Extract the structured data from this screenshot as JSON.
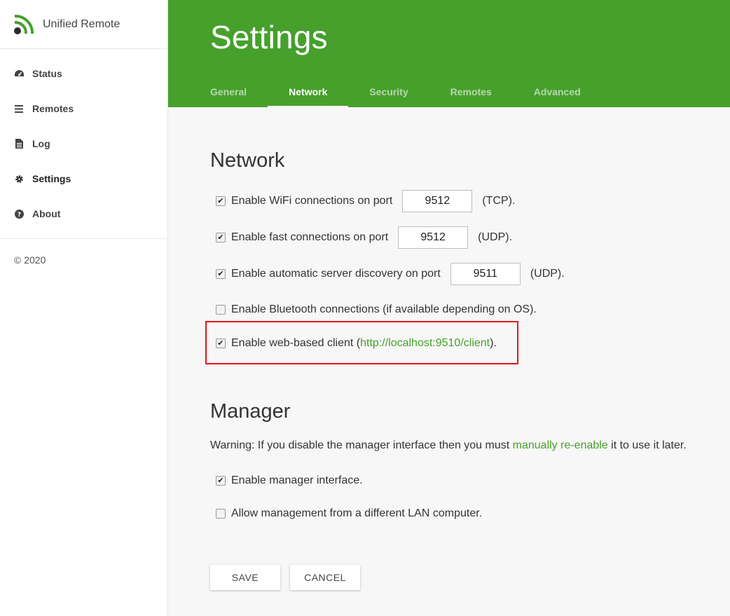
{
  "app": {
    "name": "Unified Remote",
    "copyright": "© 2020"
  },
  "colors": {
    "brand": "#46a02b",
    "highlight": "#e8141b"
  },
  "sidebar": {
    "items": [
      {
        "label": "Status",
        "icon": "dashboard-icon"
      },
      {
        "label": "Remotes",
        "icon": "menu-icon"
      },
      {
        "label": "Log",
        "icon": "document-icon"
      },
      {
        "label": "Settings",
        "icon": "gear-icon",
        "active": true
      },
      {
        "label": "About",
        "icon": "question-icon"
      }
    ]
  },
  "header": {
    "title": "Settings",
    "tabs": [
      {
        "label": "General"
      },
      {
        "label": "Network",
        "active": true
      },
      {
        "label": "Security"
      },
      {
        "label": "Remotes"
      },
      {
        "label": "Advanced"
      }
    ]
  },
  "network": {
    "title": "Network",
    "wifi": {
      "checked": true,
      "label": "Enable WiFi connections on port",
      "port": "9512",
      "suffix": "(TCP)."
    },
    "fast": {
      "checked": true,
      "label": "Enable fast connections on port",
      "port": "9512",
      "suffix": "(UDP)."
    },
    "discovery": {
      "checked": true,
      "label": "Enable automatic server discovery on port",
      "port": "9511",
      "suffix": "(UDP)."
    },
    "bluetooth": {
      "checked": false,
      "label": "Enable Bluetooth connections (if available depending on OS)."
    },
    "webclient": {
      "checked": true,
      "label_pre": "Enable web-based client (",
      "link": "http://localhost:9510/client",
      "label_post": ")."
    }
  },
  "manager": {
    "title": "Manager",
    "warning_pre": "Warning: If you disable the manager interface then you must ",
    "warning_link": "manually re-enable",
    "warning_post": " it to use it later.",
    "enable": {
      "checked": true,
      "label": "Enable manager interface."
    },
    "lan": {
      "checked": false,
      "label": "Allow management from a different LAN computer."
    }
  },
  "actions": {
    "save": "SAVE",
    "cancel": "CANCEL"
  }
}
